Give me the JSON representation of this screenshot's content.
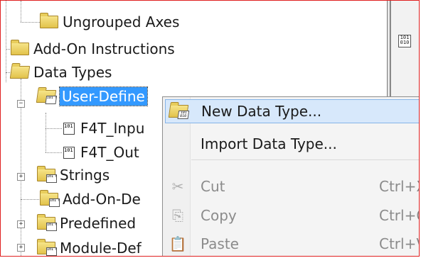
{
  "tree": {
    "items": [
      {
        "label": "Ungrouped Axes"
      },
      {
        "label": "Add-On Instructions"
      },
      {
        "label": "Data Types"
      },
      {
        "label": "User-Define"
      },
      {
        "label": "F4T_Inpu"
      },
      {
        "label": "F4T_Out"
      },
      {
        "label": "Strings"
      },
      {
        "label": "Add-On-De"
      },
      {
        "label": "Predefined"
      },
      {
        "label": "Module-Def"
      }
    ],
    "expander_collapsed": "+",
    "expander_expanded": "−",
    "type_icon_text": "101 010"
  },
  "context_menu": {
    "items": [
      {
        "label": "New Data Type...",
        "shortcut": "",
        "icon": "data-type-folder-icon"
      },
      {
        "label": "Import Data Type...",
        "shortcut": "",
        "icon": ""
      },
      {
        "label": "Cut",
        "shortcut": "Ctrl+X",
        "icon": "scissors-icon"
      },
      {
        "label": "Copy",
        "shortcut": "Ctrl+C",
        "icon": "copy-icon"
      },
      {
        "label": "Paste",
        "shortcut": "Ctrl+V",
        "icon": "paste-icon"
      }
    ],
    "icons": {
      "cut": "✂",
      "copy": "⎘",
      "paste": "📋"
    }
  },
  "colors": {
    "selection": "#3399ff",
    "menu_hover": "#d7e8fb",
    "frame_border": "#e02020"
  }
}
